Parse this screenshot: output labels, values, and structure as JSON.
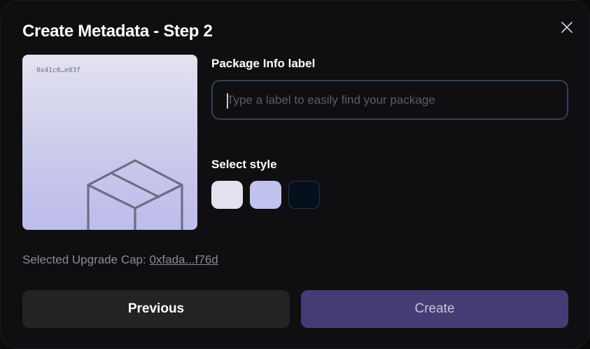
{
  "modal": {
    "title": "Create Metadata - Step 2",
    "close_icon": "close-icon"
  },
  "preview": {
    "object_id": "0x41c0…e03f",
    "icon": "package-box-icon"
  },
  "package_info": {
    "label": "Package Info label",
    "input_value": "",
    "placeholder": "Type a label to easily find your package"
  },
  "style": {
    "label": "Select style",
    "swatches": [
      {
        "name": "light",
        "color": "#e2e2ee"
      },
      {
        "name": "lavender",
        "color": "#c2c2ee"
      },
      {
        "name": "dark",
        "color": "#06101d"
      }
    ]
  },
  "upgrade_cap": {
    "label": "Selected Upgrade Cap:",
    "value": "0xfada...f76d"
  },
  "buttons": {
    "previous": "Previous",
    "create": "Create"
  },
  "colors": {
    "background": "#0f0f12",
    "accent": "#463c74",
    "input_border": "#33405a"
  }
}
